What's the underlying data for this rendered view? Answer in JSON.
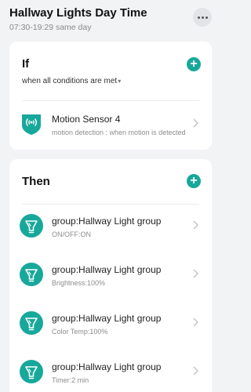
{
  "header": {
    "title": "Hallway Lights Day Time",
    "subtitle": "07:30-19:29 same day"
  },
  "if_section": {
    "title": "If",
    "condition_mode": "when all conditions are met",
    "conditions": [
      {
        "name": "Motion Sensor 4",
        "description": "motion detection : when motion is detected",
        "icon": "motion-sensor-icon"
      }
    ]
  },
  "then_section": {
    "title": "Then",
    "actions": [
      {
        "name": "group:Hallway Light group",
        "description": "ON/OFF:ON",
        "icon": "light-bulb-icon"
      },
      {
        "name": "group:Hallway Light group",
        "description": "Brightness:100%",
        "icon": "light-bulb-icon"
      },
      {
        "name": "group:Hallway Light group",
        "description": "Color Temp:100%",
        "icon": "light-bulb-icon"
      },
      {
        "name": "group:Hallway Light group",
        "description": "Timer:2 min",
        "icon": "light-bulb-icon"
      }
    ]
  },
  "colors": {
    "accent": "#17a89b",
    "background": "#f2f3f5"
  }
}
